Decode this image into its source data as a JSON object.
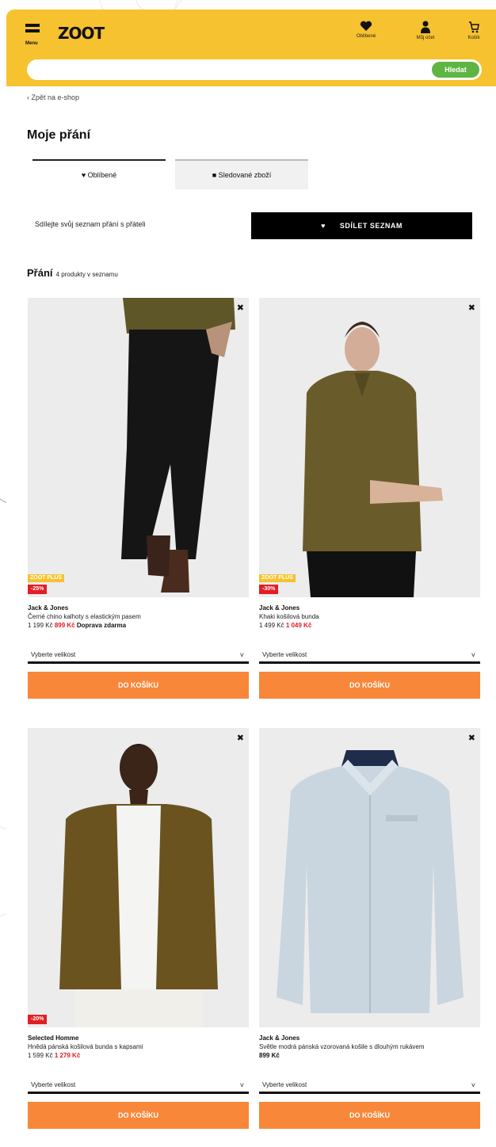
{
  "header": {
    "menu_label": "Menu",
    "logo": "ZOOT",
    "icons": [
      {
        "name": "heart-icon",
        "label": "Oblíbené"
      },
      {
        "name": "user-icon",
        "label": "Můj účet"
      },
      {
        "name": "cart-icon",
        "label": "Košík"
      }
    ]
  },
  "search": {
    "placeholder": "",
    "button": "Hledat"
  },
  "breadcrumb": "‹ Zpět na e-shop",
  "page_title": "Moje přání",
  "tabs": [
    "♥ Oblíbené",
    "■ Sledované zboží"
  ],
  "share": {
    "text": "Sdílejte svůj seznam přání s přáteli",
    "button": "SDÍLET SEZNAM"
  },
  "count": {
    "title": "Přání",
    "sub": "4 produkty v seznamu"
  },
  "products": [
    {
      "badge_yellow": "ZOOT PLUS",
      "badge_red": "-25%",
      "brand": "Jack & Jones",
      "name": "Černé chino kalhoty s elastickým pasem",
      "price_old": "1 199 Kč",
      "price_new": "899 Kč",
      "price_extra": "Doprava zdarma",
      "size": "Vyberte velikost",
      "cart": "DO KOŠÍKU"
    },
    {
      "badge_yellow": "ZOOT PLUS",
      "badge_red": "-30%",
      "brand": "Jack & Jones",
      "name": "Khaki košilová bunda",
      "price_old": "1 499 Kč",
      "price_new": "1 049 Kč",
      "price_extra": "",
      "size": "Vyberte velikost",
      "cart": "DO KOŠÍKU"
    },
    {
      "badge_yellow": "",
      "badge_red": "-20%",
      "brand": "Selected Homme",
      "name": "Hnědá pánská košilová bunda s kapsami",
      "price_old": "1 599 Kč",
      "price_new": "1 279 Kč",
      "price_extra": "",
      "size": "Vyberte velikost",
      "cart": "DO KOŠÍKU"
    },
    {
      "badge_yellow": "",
      "badge_red": "",
      "brand": "Jack & Jones",
      "name": "Světle modrá pánská vzorovaná košile s dlouhým rukávem",
      "price_old": "",
      "price_new": "",
      "price_extra": "899 Kč",
      "size": "Vyberte velikost",
      "cart": "DO KOŠÍKU"
    }
  ],
  "colors": {
    "header_bg": "#f6c22f",
    "search_button": "#5fb542",
    "cart_button": "#f8873a",
    "sale_red": "#e31e24",
    "share_button": "#000000"
  }
}
